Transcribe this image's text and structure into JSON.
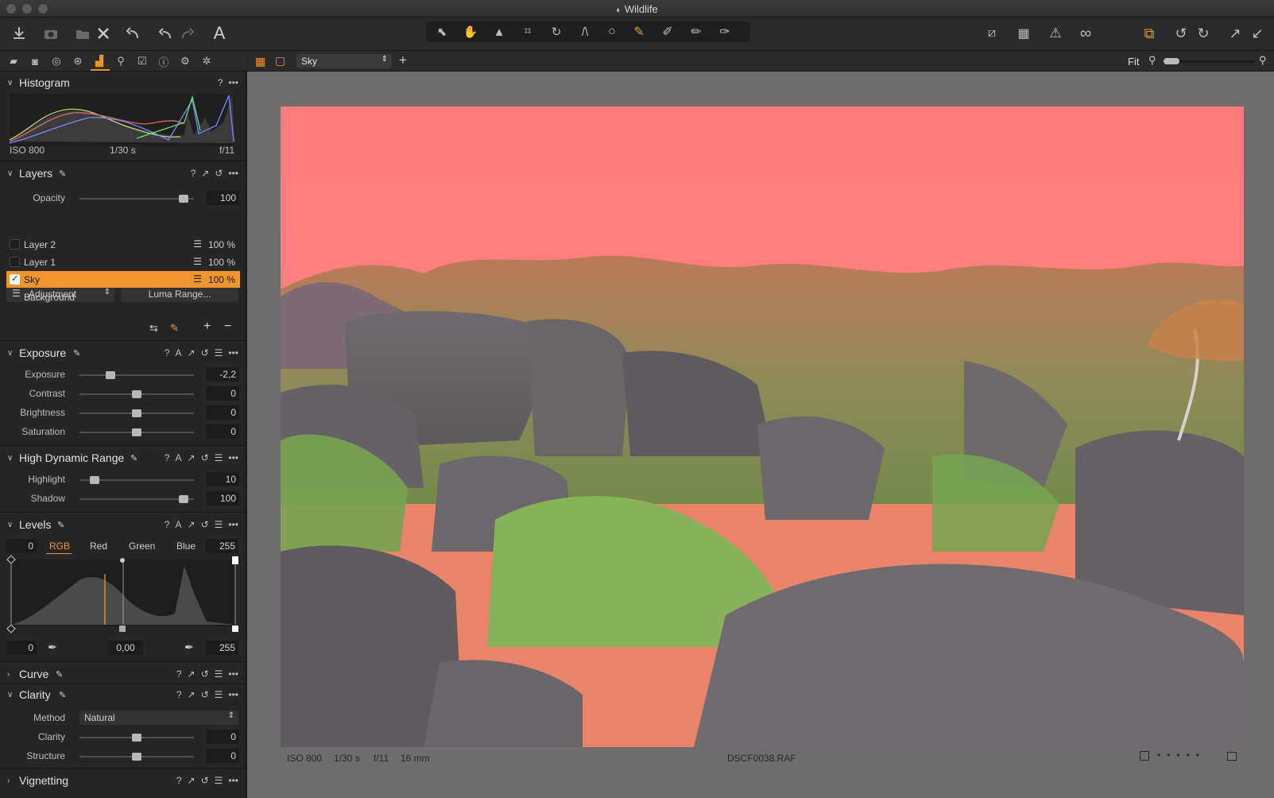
{
  "window": {
    "title": "Wildlife"
  },
  "viewer_bar": {
    "variant": "Sky",
    "zoom_label": "Fit"
  },
  "histogram": {
    "title": "Histogram",
    "iso": "ISO 800",
    "shutter": "1/30 s",
    "aperture": "f/11"
  },
  "layers": {
    "title": "Layers",
    "opacity_label": "Opacity",
    "opacity_value": "100",
    "opacity_fraction": 0.95,
    "adjustment_label": "Adjustment",
    "luma_button": "Luma Range...",
    "items": [
      {
        "name": "Layer 2",
        "pct": "100 %"
      },
      {
        "name": "Layer 1",
        "pct": "100 %"
      },
      {
        "name": "Sky",
        "pct": "100 %"
      },
      {
        "name": "Background",
        "pct": ""
      }
    ]
  },
  "exposure": {
    "title": "Exposure",
    "rows": [
      {
        "label": "Exposure",
        "value": "-2,2",
        "fraction": 0.25
      },
      {
        "label": "Contrast",
        "value": "0",
        "fraction": 0.5
      },
      {
        "label": "Brightness",
        "value": "0",
        "fraction": 0.5
      },
      {
        "label": "Saturation",
        "value": "0",
        "fraction": 0.5
      }
    ]
  },
  "hdr": {
    "title": "High Dynamic Range",
    "rows": [
      {
        "label": "Highlight",
        "value": "10",
        "fraction": 0.1
      },
      {
        "label": "Shadow",
        "value": "100",
        "fraction": 0.95
      }
    ]
  },
  "levels": {
    "title": "Levels",
    "low": "0",
    "high": "255",
    "tabs": [
      "RGB",
      "Red",
      "Green",
      "Blue"
    ],
    "bottom_low": "0",
    "mid": "0,00",
    "bottom_high": "255"
  },
  "curve": {
    "title": "Curve"
  },
  "clarity": {
    "title": "Clarity",
    "method_label": "Method",
    "method_value": "Natural",
    "rows": [
      {
        "label": "Clarity",
        "value": "0",
        "fraction": 0.5
      },
      {
        "label": "Structure",
        "value": "0",
        "fraction": 0.5
      }
    ]
  },
  "vignetting": {
    "title": "Vignetting"
  },
  "image_info": {
    "iso": "ISO 800",
    "shutter": "1/30 s",
    "aperture": "f/11",
    "focal": "16 mm",
    "filename": "DSCF0038.RAF"
  },
  "colors": {
    "accent": "#f0952e",
    "mask": "#ff7b7b"
  }
}
